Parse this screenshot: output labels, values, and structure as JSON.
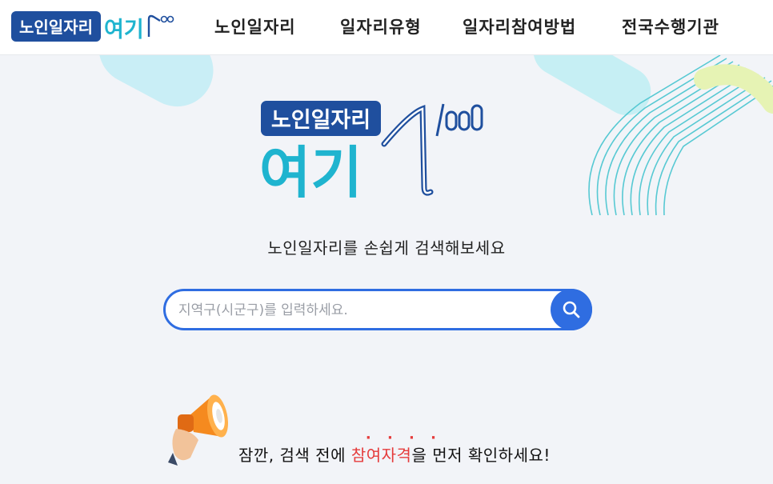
{
  "header": {
    "logo_text": "노인일자리여기",
    "nav": [
      {
        "label": "노인일자리"
      },
      {
        "label": "일자리유형"
      },
      {
        "label": "일자리참여방법"
      },
      {
        "label": "전국수행기관"
      }
    ]
  },
  "hero": {
    "logo_top": "노인일자리",
    "logo_bottom": "여기",
    "tagline": "노인일자리를 손쉽게 검색해보세요"
  },
  "search": {
    "placeholder": "지역구(시군구)를 입력하세요.",
    "value": ""
  },
  "notice": {
    "prefix": "잠깐, 검색 전에 ",
    "highlight": "참여자격",
    "suffix": "을 먼저 확인하세요!"
  },
  "colors": {
    "primary_blue": "#2f6de1",
    "logo_navy": "#1f4f9e",
    "logo_teal": "#1fb4cf",
    "highlight_red": "#e53b3b"
  }
}
